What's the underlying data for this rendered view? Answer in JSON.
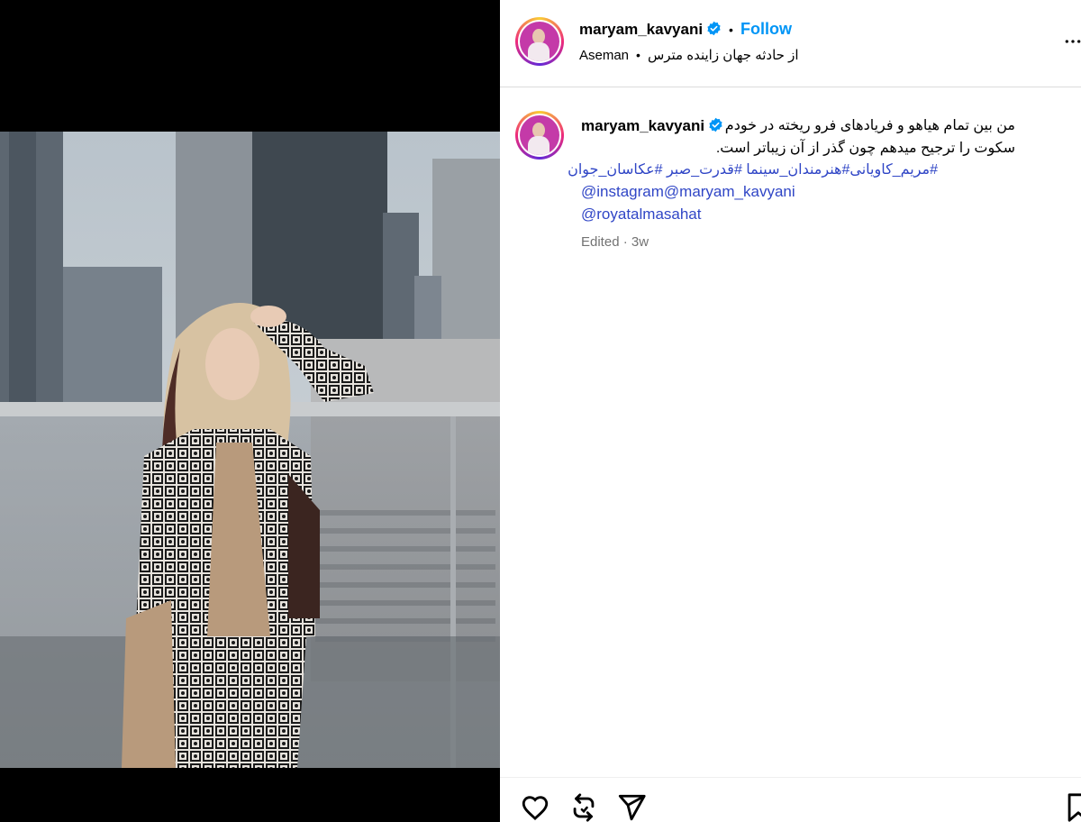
{
  "post": {
    "username": "maryam_kavyani",
    "follow_label": "Follow",
    "location": "Aseman",
    "subtitle": "از حادثه جهان زاینده مترس"
  },
  "caption": {
    "username": "maryam_kavyani",
    "line1": "من بین تمام هیاهو و فریادهای فرو ریخته در خودم",
    "line2": "سکوت را ترجیح میدهم چون گذر از آن زیباتر است.",
    "hashtags": "#مریم_کاویانی#هنرمندان_سینما #قدرت_صبر #عکاسان_جوان",
    "mention1": "@instagram@maryam_kavyani",
    "mention2": "@royatalmasahat",
    "edited": "Edited",
    "time": "3w"
  },
  "icons": {
    "verified": "verified-badge-icon",
    "more": "more-options-icon",
    "like": "heart-icon",
    "repost": "repost-icon",
    "share": "share-icon",
    "save": "bookmark-icon"
  },
  "colors": {
    "link_blue": "#0095f6",
    "hashtag_blue": "#3046c6",
    "muted": "#737373"
  }
}
